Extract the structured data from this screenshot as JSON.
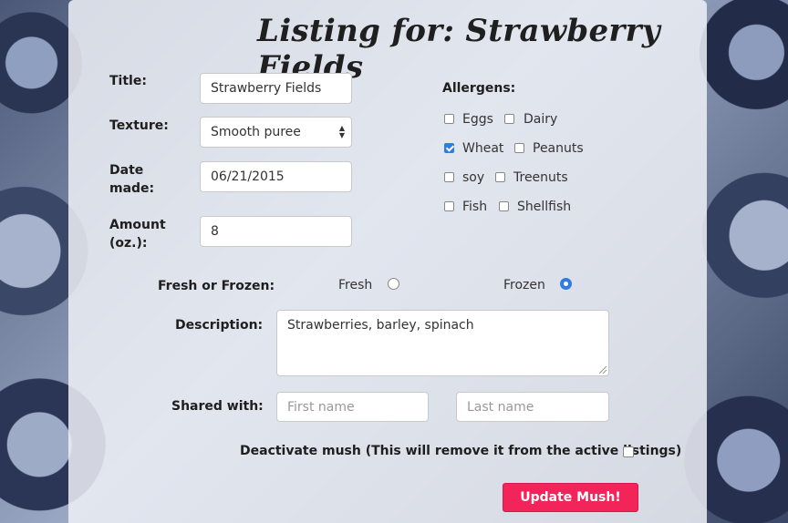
{
  "page_title": "Listing for: Strawberry Fields",
  "form": {
    "title": {
      "label": "Title:",
      "value": "Strawberry Fields"
    },
    "texture": {
      "label": "Texture:",
      "value": "Smooth puree"
    },
    "date_made": {
      "label_line1": "Date",
      "label_line2": "made:",
      "value": "06/21/2015"
    },
    "amount": {
      "label_line1": "Amount",
      "label_line2": "(oz.):",
      "value": "8"
    },
    "allergens": {
      "label": "Allergens:",
      "items": [
        {
          "label": "Eggs",
          "checked": false
        },
        {
          "label": "Dairy",
          "checked": false
        },
        {
          "label": "Wheat",
          "checked": true
        },
        {
          "label": "Peanuts",
          "checked": false
        },
        {
          "label": "soy",
          "checked": false
        },
        {
          "label": "Treenuts",
          "checked": false
        },
        {
          "label": "Fish",
          "checked": false
        },
        {
          "label": "Shellfish",
          "checked": false
        }
      ]
    },
    "fresh_or_frozen": {
      "label": "Fresh or Frozen:",
      "options": [
        {
          "label": "Fresh",
          "selected": false
        },
        {
          "label": "Frozen",
          "selected": true
        }
      ]
    },
    "description": {
      "label": "Description:",
      "value": "Strawberries, barley, spinach"
    },
    "shared_with": {
      "label": "Shared with:",
      "first_name_placeholder": "First name",
      "last_name_placeholder": "Last name"
    },
    "deactivate": {
      "label": "Deactivate mush (This will remove it from the active listings)",
      "checked": false
    },
    "submit_label": "Update Mush!"
  },
  "colors": {
    "accent": "#f2245a",
    "checkbox_checked": "#2f7de1",
    "panel": "#eef0f6"
  },
  "background": "blueberries-photo"
}
